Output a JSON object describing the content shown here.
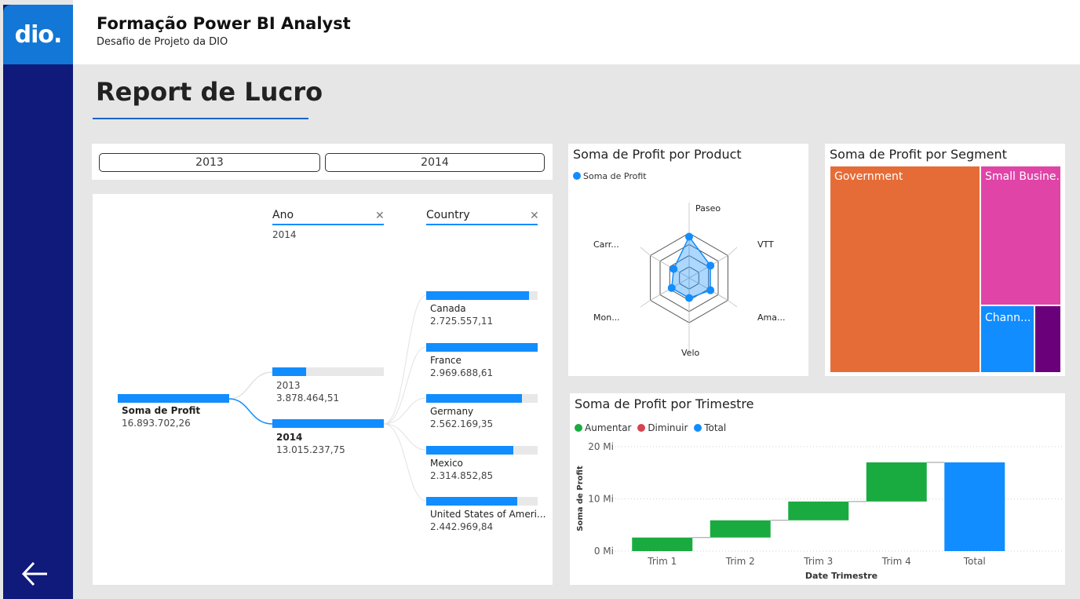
{
  "app": {
    "logo": "dio.",
    "title": "Formação Power BI Analyst",
    "subtitle": "Desafio de Projeto da DIO",
    "page_title": "Report de Lucro"
  },
  "slicer": {
    "options": [
      "2013",
      "2014"
    ]
  },
  "decomposition": {
    "root_label": "Soma de Profit",
    "root_value": "16.893.702,26",
    "level1_header": "Ano",
    "level1_filter": "2014",
    "level2_header": "Country",
    "level1": [
      {
        "label": "2013",
        "value": "3.878.464,51",
        "fill": 0.3,
        "selected": false
      },
      {
        "label": "2014",
        "value": "13.015.237,75",
        "fill": 1.0,
        "selected": true
      }
    ],
    "level2": [
      {
        "label": "Canada",
        "value": "2.725.557,11",
        "fill": 0.92
      },
      {
        "label": "France",
        "value": "2.969.688,61",
        "fill": 1.0
      },
      {
        "label": "Germany",
        "value": "2.562.169,35",
        "fill": 0.86
      },
      {
        "label": "Mexico",
        "value": "2.314.852,85",
        "fill": 0.78
      },
      {
        "label": "United States of Ameri...",
        "value": "2.442.969,84",
        "fill": 0.82
      }
    ]
  },
  "radar": {
    "title": "Soma de Profit por Product",
    "legend": "Soma de Profit",
    "axes": [
      "Paseo",
      "VTT",
      "Ama...",
      "Velo",
      "Mon...",
      "Carr..."
    ],
    "values": [
      0.92,
      0.55,
      0.55,
      0.45,
      0.45,
      0.4
    ],
    "color": "#118dff"
  },
  "treemap": {
    "title": "Soma de Profit por Segment",
    "tiles": [
      {
        "label": "Government",
        "color": "#e66c37"
      },
      {
        "label": "Small Busine...",
        "color": "#e044a7"
      },
      {
        "label": "Chann...",
        "color": "#118dff"
      },
      {
        "label": "",
        "color": "#6b007b"
      }
    ]
  },
  "waterfall": {
    "title": "Soma de Profit por Trimestre",
    "legend": [
      {
        "label": "Aumentar",
        "color": "#1aab40"
      },
      {
        "label": "Diminuir",
        "color": "#d64550"
      },
      {
        "label": "Total",
        "color": "#118dff"
      }
    ],
    "ylabel": "Soma de Profit",
    "xlabel": "Date Trimestre",
    "yticks": [
      "0 Mi",
      "10 Mi",
      "20 Mi"
    ]
  },
  "chart_data": {
    "type": "bar",
    "categories": [
      "Trim 1",
      "Trim 2",
      "Trim 3",
      "Trim 4",
      "Total"
    ],
    "values": [
      2.6,
      3.3,
      3.6,
      7.5,
      17.0
    ],
    "ylim": [
      0,
      20
    ]
  }
}
